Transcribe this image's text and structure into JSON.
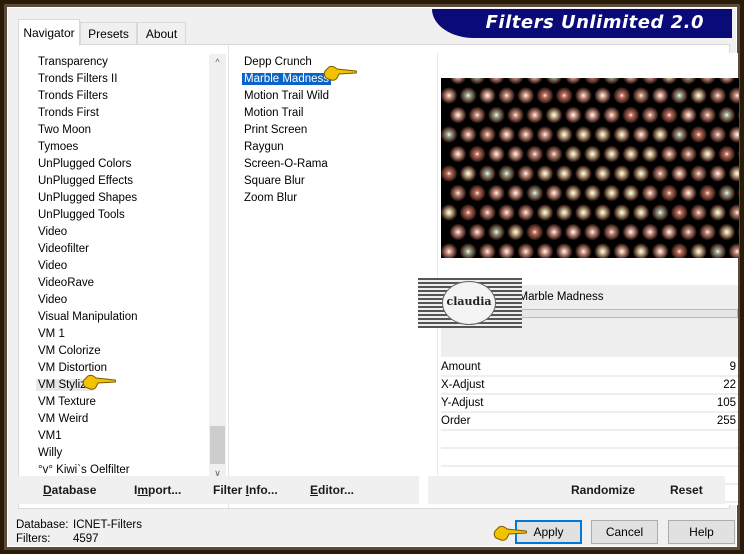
{
  "app": {
    "title": "Filters Unlimited 2.0"
  },
  "tabs": [
    {
      "label": "Navigator",
      "active": true
    },
    {
      "label": "Presets",
      "active": false
    },
    {
      "label": "About",
      "active": false
    }
  ],
  "categories": {
    "items": [
      "Transparency",
      "Tronds Filters II",
      "Tronds Filters",
      "Tronds First",
      "Two Moon",
      "Tymoes",
      "UnPlugged Colors",
      "UnPlugged Effects",
      "UnPlugged Shapes",
      "UnPlugged Tools",
      "Video",
      "Videofilter",
      "Video",
      "VideoRave",
      "Video",
      "Visual Manipulation",
      "VM 1",
      "VM Colorize",
      "VM Distortion",
      "VM Stylize",
      "VM Texture",
      "VM Weird",
      "VM1",
      "Willy",
      "°v° Kiwi`s Oelfilter"
    ],
    "highlighted": "VM Stylize",
    "scroll_position": 0.92
  },
  "filters": {
    "items": [
      "Depp Crunch",
      "Marble Madness",
      "Motion Trail Wild",
      "Motion Trail",
      "Print Screen",
      "Raygun",
      "Screen-O-Rama",
      "Square Blur",
      "Zoom Blur"
    ],
    "selected": "Marble Madness"
  },
  "preview": {
    "filter_title": "Marble Madness",
    "watermark": "claudia"
  },
  "parameters": [
    {
      "label": "Amount",
      "value": "9"
    },
    {
      "label": "X-Adjust",
      "value": "22"
    },
    {
      "label": "Y-Adjust",
      "value": "105"
    },
    {
      "label": "Order",
      "value": "255"
    }
  ],
  "toolbar": {
    "database": "Database",
    "import": "Import...",
    "filter_info": "Filter Info...",
    "editor": "Editor...",
    "randomize": "Randomize",
    "reset": "Reset"
  },
  "status": {
    "database_label": "Database:",
    "database_value": "ICNET-Filters",
    "filters_label": "Filters:",
    "filters_value": "4597"
  },
  "buttons": {
    "apply": "Apply",
    "cancel": "Cancel",
    "help": "Help"
  },
  "colors": {
    "selection": "#0a64c8",
    "banner": "#0a0a78",
    "default_button_border": "#0078d7"
  }
}
